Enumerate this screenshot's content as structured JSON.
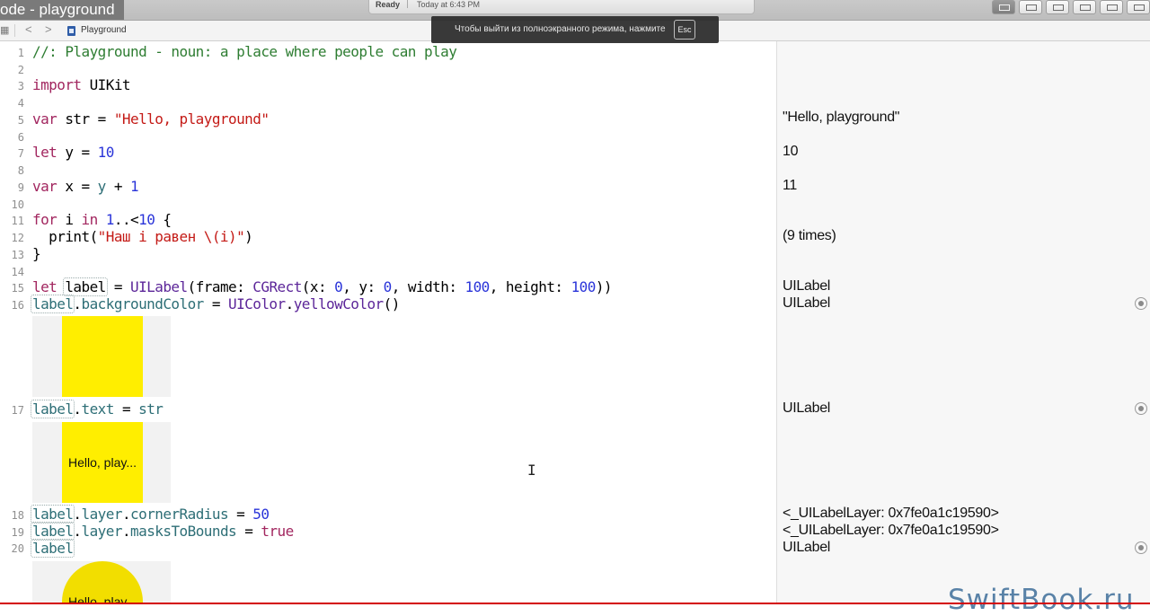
{
  "window": {
    "title": "ode - playground"
  },
  "activity": {
    "status": "Ready",
    "time": "Today at 6:43 PM"
  },
  "jumpbar": {
    "file": "Playground",
    "back": "<",
    "forward": ">"
  },
  "toast": {
    "text": "Чтобы выйти из полноэкранного режима, нажмите",
    "key": "Esc"
  },
  "code": {
    "l1": "//: Playground - noun: a place where people can play",
    "l3_kw": "import",
    "l3_rest": " UIKit",
    "l5_kw": "var",
    "l5_mid": " str = ",
    "l5_str": "\"Hello, playground\"",
    "l7_kw": "let",
    "l7_mid": " y = ",
    "l7_num": "10",
    "l9_kw": "var",
    "l9_mid": " x = ",
    "l9_var": "y",
    "l9_op": " + ",
    "l9_num": "1",
    "l11_kw": "for",
    "l11_a": " i ",
    "l11_in": "in",
    "l11_sp": " ",
    "l11_n1": "1",
    "l11_op": "..<",
    "l11_n2": "10",
    "l11_end": " {",
    "l12_fn": "  print(",
    "l12_str": "\"Наш i равен \\(i)\"",
    "l12_end": ")",
    "l13": "}",
    "l15_kw": "let",
    "l15_sp": " ",
    "l15_label": "label",
    "l15_eq": " = ",
    "l15_tp1": "UILabel",
    "l15_a": "(frame: ",
    "l15_tp2": "CGRect",
    "l15_b": "(x: ",
    "l15_n0": "0",
    "l15_c": ", y: ",
    "l15_n1": "0",
    "l15_d": ", width: ",
    "l15_n2": "100",
    "l15_e": ", height: ",
    "l15_n3": "100",
    "l15_f": "))",
    "l16_label": "label",
    "l16_a": ".",
    "l16_prop": "backgroundColor",
    "l16_eq": " = ",
    "l16_tp": "UIColor",
    "l16_b": ".",
    "l16_fn": "yellowColor",
    "l16_c": "()",
    "l17_label": "label",
    "l17_a": ".",
    "l17_prop": "text",
    "l17_eq": " = ",
    "l17_var": "str",
    "l18_label": "label",
    "l18_a": ".",
    "l18_prop1": "layer",
    "l18_b": ".",
    "l18_prop2": "cornerRadius",
    "l18_eq": " = ",
    "l18_num": "50",
    "l19_label": "label",
    "l19_a": ".",
    "l19_prop1": "layer",
    "l19_b": ".",
    "l19_prop2": "masksToBounds",
    "l19_eq": " = ",
    "l19_kw": "true",
    "l20_label": "label"
  },
  "line_numbers": [
    "1",
    "2",
    "3",
    "4",
    "5",
    "6",
    "7",
    "8",
    "9",
    "10",
    "11",
    "12",
    "13",
    "14",
    "15",
    "16",
    "17",
    "18",
    "19",
    "20"
  ],
  "previews": {
    "p2_text": "Hello, play...",
    "p3_text": "Hello, play..."
  },
  "results": {
    "r5": "\"Hello, playground\"",
    "r7": "10",
    "r9": "11",
    "r12": "(9 times)",
    "r15": "UILabel",
    "r16": "UILabel",
    "r17": "UILabel",
    "r18": "<_UILabelLayer: 0x7fe0a1c19590>",
    "r19": "<_UILabelLayer: 0x7fe0a1c19590>",
    "r20": "UILabel"
  },
  "brand": "SwiftBook.ru",
  "colors": {
    "comment": "#2e7d32",
    "keyword": "#a2265f",
    "string": "#c41a16",
    "number": "#2a34d9",
    "type": "#5c2699",
    "variable": "#2d6e76",
    "yellow": "#ffee00"
  }
}
